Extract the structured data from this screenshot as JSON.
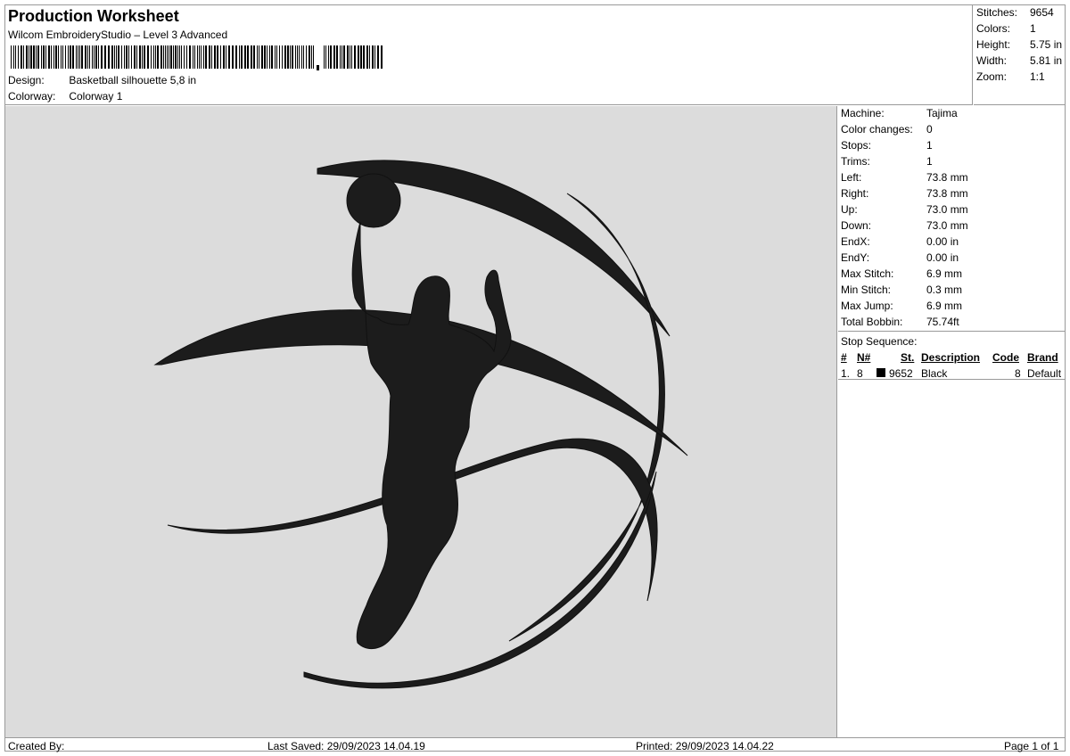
{
  "header": {
    "title": "Production Worksheet",
    "subtitle": "Wilcom EmbroideryStudio – Level 3 Advanced",
    "design_label": "Design:",
    "design_value": "Basketball silhouette 5,8 in",
    "colorway_label": "Colorway:",
    "colorway_value": "Colorway 1"
  },
  "summary": {
    "stitches_label": "Stitches:",
    "stitches_value": "9654",
    "colors_label": "Colors:",
    "colors_value": "1",
    "height_label": "Height:",
    "height_value": "5.75 in",
    "width_label": "Width:",
    "width_value": "5.81 in",
    "zoom_label": "Zoom:",
    "zoom_value": "1:1"
  },
  "machine": {
    "rows": [
      {
        "label": "Machine:",
        "value": "Tajima"
      },
      {
        "label": "Color changes:",
        "value": "0"
      },
      {
        "label": "Stops:",
        "value": "1"
      },
      {
        "label": "Trims:",
        "value": "1"
      },
      {
        "label": "Left:",
        "value": "73.8 mm"
      },
      {
        "label": "Right:",
        "value": "73.8 mm"
      },
      {
        "label": "Up:",
        "value": "73.0 mm"
      },
      {
        "label": "Down:",
        "value": "73.0 mm"
      },
      {
        "label": "EndX:",
        "value": "0.00 in"
      },
      {
        "label": "EndY:",
        "value": "0.00 in"
      },
      {
        "label": "Max Stitch:",
        "value": "6.9 mm"
      },
      {
        "label": "Min Stitch:",
        "value": "0.3 mm"
      },
      {
        "label": "Max Jump:",
        "value": "6.9 mm"
      },
      {
        "label": "Total Bobbin:",
        "value": "75.74ft"
      }
    ]
  },
  "stop_sequence": {
    "caption": "Stop Sequence:",
    "headers": {
      "num": "#",
      "n": "N#",
      "st": "St.",
      "description": "Description",
      "code": "Code",
      "brand": "Brand"
    },
    "rows": [
      {
        "num": "1.",
        "n": "8",
        "swatch_color": "#000000",
        "st": "9652",
        "description": "Black",
        "code": "8",
        "brand": "Default"
      }
    ]
  },
  "footer": {
    "created_by": "Created By:",
    "last_saved": "Last Saved: 29/09/2023 14.04.19",
    "printed": "Printed: 29/09/2023 14.04.22",
    "page": "Page 1 of 1"
  },
  "colors": {
    "canvas_bg": "#dcdcdc",
    "thread": "#1c1c1c"
  }
}
